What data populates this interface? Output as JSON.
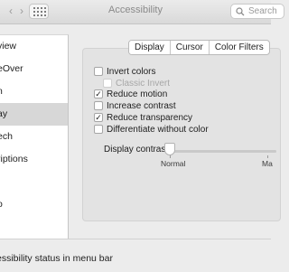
{
  "window": {
    "title": "Accessibility",
    "back_glyph": "‹",
    "forward_glyph": "›",
    "search_placeholder": "Search"
  },
  "sidebar": {
    "items": [
      {
        "label": "view"
      },
      {
        "label": "eOver"
      },
      {
        "label": "n"
      },
      {
        "label": "ay",
        "selected": true
      },
      {
        "label": "ech"
      },
      {
        "label": "riptions"
      },
      {
        "label": "o"
      }
    ]
  },
  "tabs": [
    "Display",
    "Cursor",
    "Color Filters"
  ],
  "options": [
    {
      "label": "Invert colors",
      "checked": false,
      "mark": ""
    },
    {
      "label": "Classic Invert",
      "checked": false,
      "disabled": true,
      "mark": ""
    },
    {
      "label": "Reduce motion",
      "checked": true,
      "mark": "✓"
    },
    {
      "label": "Increase contrast",
      "checked": false,
      "mark": ""
    },
    {
      "label": "Reduce transparency",
      "checked": true,
      "mark": "✓"
    },
    {
      "label": "Differentiate without color",
      "checked": false,
      "mark": ""
    }
  ],
  "contrast": {
    "label": "Display contrast:",
    "min_label": "Normal",
    "max_label": "Ma",
    "value_fraction": 0.0
  },
  "bottom": {
    "status_text": "essibility status in menu bar"
  },
  "colors": {
    "window_bg": "#ececec",
    "sidebar_bg": "#ffffff",
    "selected_row": "#d7d7d7"
  }
}
